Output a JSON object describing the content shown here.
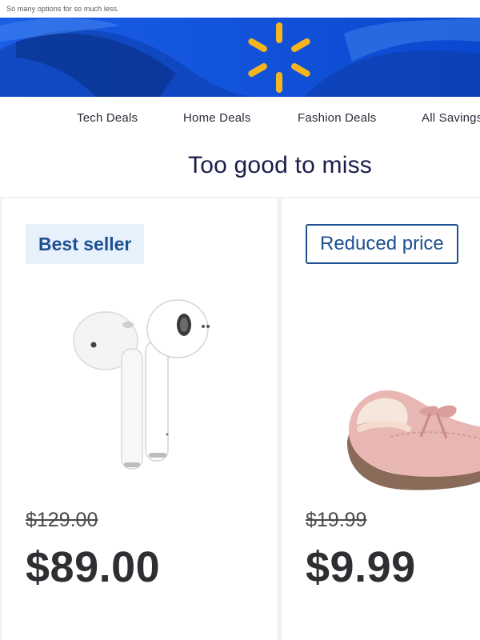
{
  "preheader": "So many options for so much less.",
  "nav": {
    "items": [
      "Tech Deals",
      "Home Deals",
      "Fashion Deals",
      "All Savings"
    ]
  },
  "section_title": "Too good to miss",
  "products": [
    {
      "badge": "Best seller",
      "image_icon": "earbuds-image",
      "was_price": "$129.00",
      "price": "$89.00"
    },
    {
      "badge": "Reduced price",
      "image_icon": "slipper-image",
      "was_price": "$19.99",
      "price": "$9.99"
    }
  ],
  "colors": {
    "brand_blue": "#0b4fd6",
    "spark_yellow": "#f5b51e",
    "badge_text": "#1d4f91",
    "title": "#1b1d4a"
  }
}
